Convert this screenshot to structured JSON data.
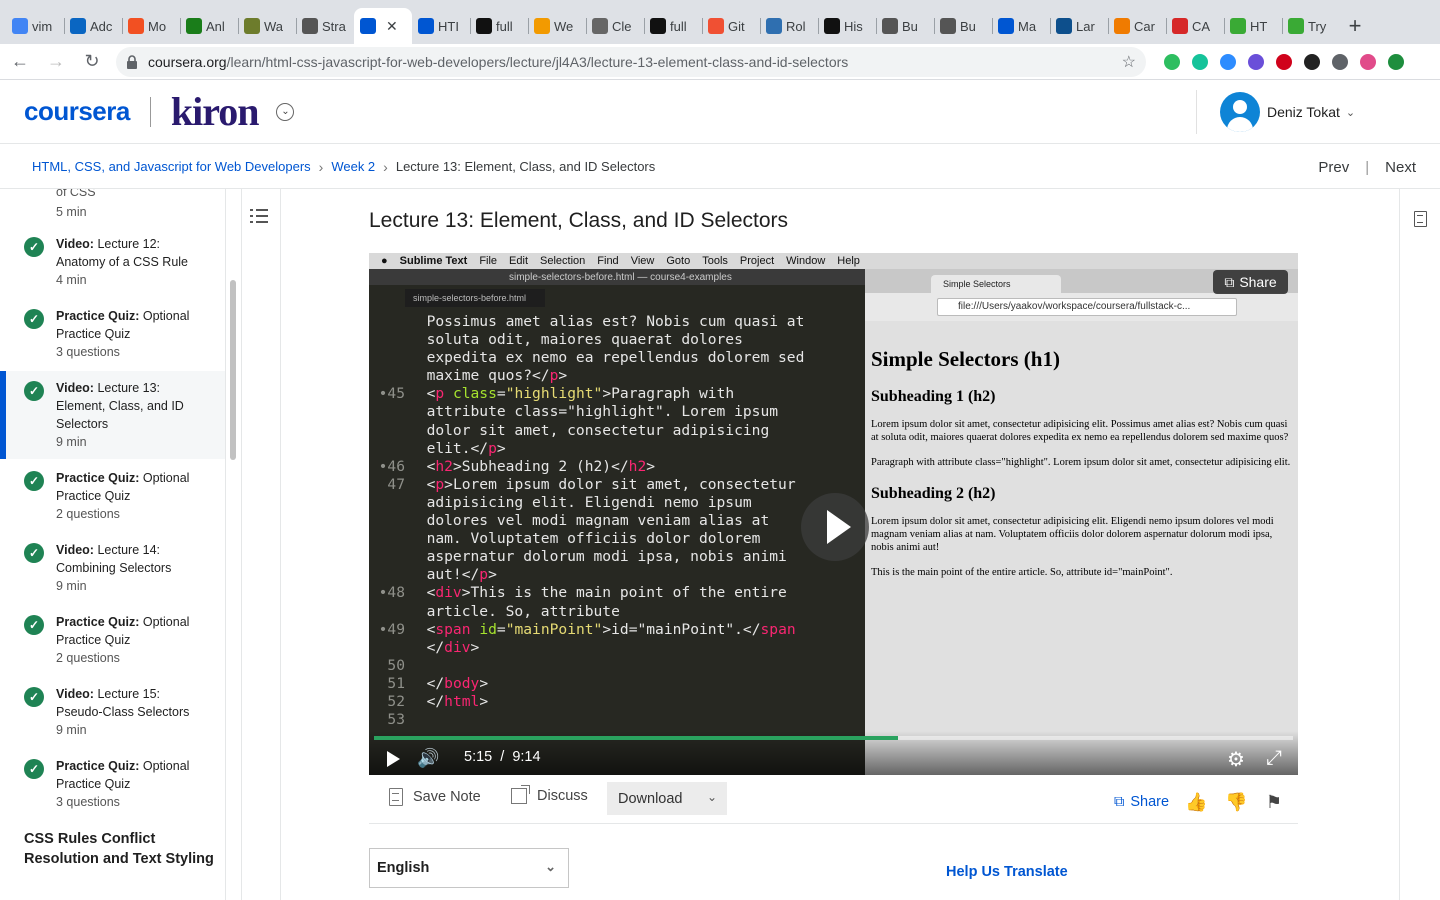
{
  "browser": {
    "tabs": [
      {
        "label": "vim",
        "icon": "google-icon",
        "color": "#4285f4"
      },
      {
        "label": "Adc",
        "icon": "linkedin-icon",
        "color": "#0a66c2"
      },
      {
        "label": "Mo",
        "icon": "microsoft-icon",
        "color": "#f25022"
      },
      {
        "label": "Anl",
        "icon": "udemy-icon",
        "color": "#1a7d1a"
      },
      {
        "label": "Wa",
        "icon": "ru-icon",
        "color": "#6d7c2c"
      },
      {
        "label": "Stra",
        "icon": "globe-icon",
        "color": "#555555"
      },
      {
        "label": "",
        "icon": "coursera-icon",
        "color": "#0056d2",
        "active": true
      },
      {
        "label": "HTI",
        "icon": "coursera-icon",
        "color": "#0056d2"
      },
      {
        "label": "full",
        "icon": "github-icon",
        "color": "#111111"
      },
      {
        "label": "We",
        "icon": "amazon-icon",
        "color": "#f29a00"
      },
      {
        "label": "Cle",
        "icon": "shield-icon",
        "color": "#666666"
      },
      {
        "label": "full",
        "icon": "github-icon",
        "color": "#111111"
      },
      {
        "label": "Git",
        "icon": "git-icon",
        "color": "#f05033"
      },
      {
        "label": "Rol",
        "icon": "app-icon",
        "color": "#2f6fb0"
      },
      {
        "label": "His",
        "icon": "github-icon",
        "color": "#111111"
      },
      {
        "label": "Bu",
        "icon": "globe-icon",
        "color": "#555555"
      },
      {
        "label": "Bu",
        "icon": "globe-icon",
        "color": "#555555"
      },
      {
        "label": "Ma",
        "icon": "coursera-icon",
        "color": "#0056d2"
      },
      {
        "label": "Lar",
        "icon": "lt-icon",
        "color": "#0d4f8c"
      },
      {
        "label": "Car",
        "icon": "flag-icon",
        "color": "#f07b00"
      },
      {
        "label": "CA",
        "icon": "circle-icon",
        "color": "#d62828"
      },
      {
        "label": "HT",
        "icon": "w3-icon",
        "color": "#3aaa35"
      },
      {
        "label": "Try",
        "icon": "w3-icon",
        "color": "#3aaa35"
      }
    ],
    "url_host": "coursera.org",
    "url_path": "/learn/html-css-javascript-for-web-developers/lecture/jl4A3/lecture-13-element-class-and-id-selectors",
    "extensions": [
      {
        "name": "evernote-icon",
        "color": "#2dbe60"
      },
      {
        "name": "grammarly-icon",
        "color": "#15c39a"
      },
      {
        "name": "zoom-icon",
        "color": "#2d8cff"
      },
      {
        "name": "check-icon",
        "color": "#6a4fd9"
      },
      {
        "name": "adblock-icon",
        "color": "#d0021b"
      },
      {
        "name": "react-icon",
        "color": "#222222"
      },
      {
        "name": "puzzle-icon",
        "color": "#5f6368"
      },
      {
        "name": "color-icon",
        "color": "#e14b8a"
      },
      {
        "name": "update-icon",
        "color": "#1e8e3e"
      }
    ]
  },
  "header": {
    "brand": "coursera",
    "partner": "kiron",
    "user_name": "Deniz Tokat"
  },
  "breadcrumb": {
    "course": "HTML, CSS, and Javascript for Web Developers",
    "week": "Week 2",
    "current": "Lecture 13: Element, Class, and ID Selectors",
    "prev": "Prev",
    "next": "Next"
  },
  "sidebar": {
    "top_fragment": "of CSS",
    "top_fragment_meta": "5 min",
    "items": [
      {
        "type": "Video:",
        "title": "Lecture 12: Anatomy of a CSS Rule",
        "meta": "4 min"
      },
      {
        "type": "Practice Quiz:",
        "title": "Optional Practice Quiz",
        "meta": "3 questions"
      },
      {
        "type": "Video:",
        "title": "Lecture 13: Element, Class, and ID Selectors",
        "meta": "9 min",
        "active": true
      },
      {
        "type": "Practice Quiz:",
        "title": "Optional Practice Quiz",
        "meta": "2 questions"
      },
      {
        "type": "Video:",
        "title": "Lecture 14: Combining Selectors",
        "meta": "9 min"
      },
      {
        "type": "Practice Quiz:",
        "title": "Optional Practice Quiz",
        "meta": "2 questions"
      },
      {
        "type": "Video:",
        "title": "Lecture 15: Pseudo-Class Selectors",
        "meta": "9 min"
      },
      {
        "type": "Practice Quiz:",
        "title": "Optional Practice Quiz",
        "meta": "3 questions"
      }
    ],
    "section": "CSS Rules Conflict Resolution and Text Styling"
  },
  "lecture": {
    "title": "Lecture 13: Element, Class, and ID Selectors"
  },
  "video": {
    "mac_menu": [
      "Sublime Text",
      "File",
      "Edit",
      "Selection",
      "Find",
      "View",
      "Goto",
      "Tools",
      "Project",
      "Window",
      "Help"
    ],
    "editor_title": "simple-selectors-before.html — course4-examples",
    "editor_tab": "simple-selectors-before.html",
    "browser_tab": "Simple Selectors",
    "browser_url": "file:///Users/yaakov/workspace/coursera/fullstack-c...",
    "page_h1": "Simple Selectors (h1)",
    "page_h2a": "Subheading 1 (h2)",
    "page_p1": "Lorem ipsum dolor sit amet, consectetur adipisicing elit. Possimus amet alias est? Nobis cum quasi at soluta odit, maiores quaerat dolores expedita ex nemo ea repellendus dolorem sed maxime quos?",
    "page_p2": "Paragraph with attribute class=\"highlight\". Lorem ipsum dolor sit amet, consectetur adipisicing elit.",
    "page_h2b": "Subheading 2 (h2)",
    "page_p3": "Lorem ipsum dolor sit amet, consectetur adipisicing elit. Eligendi nemo ipsum dolores vel modi magnam veniam alias at nam. Voluptatem officiis dolor dolorem aspernatur dolorum modi ipsa, nobis animi aut!",
    "page_p4": "This is the main point of the entire article. So, attribute id=\"mainPoint\".",
    "share_label": "Share",
    "current_time": "5:15",
    "time_sep": "/",
    "duration": "9:14",
    "progress": 0.57
  },
  "actions": {
    "save_note": "Save Note",
    "discuss": "Discuss",
    "download": "Download",
    "share": "Share"
  },
  "language": {
    "selected": "English",
    "help_translate": "Help Us Translate"
  }
}
